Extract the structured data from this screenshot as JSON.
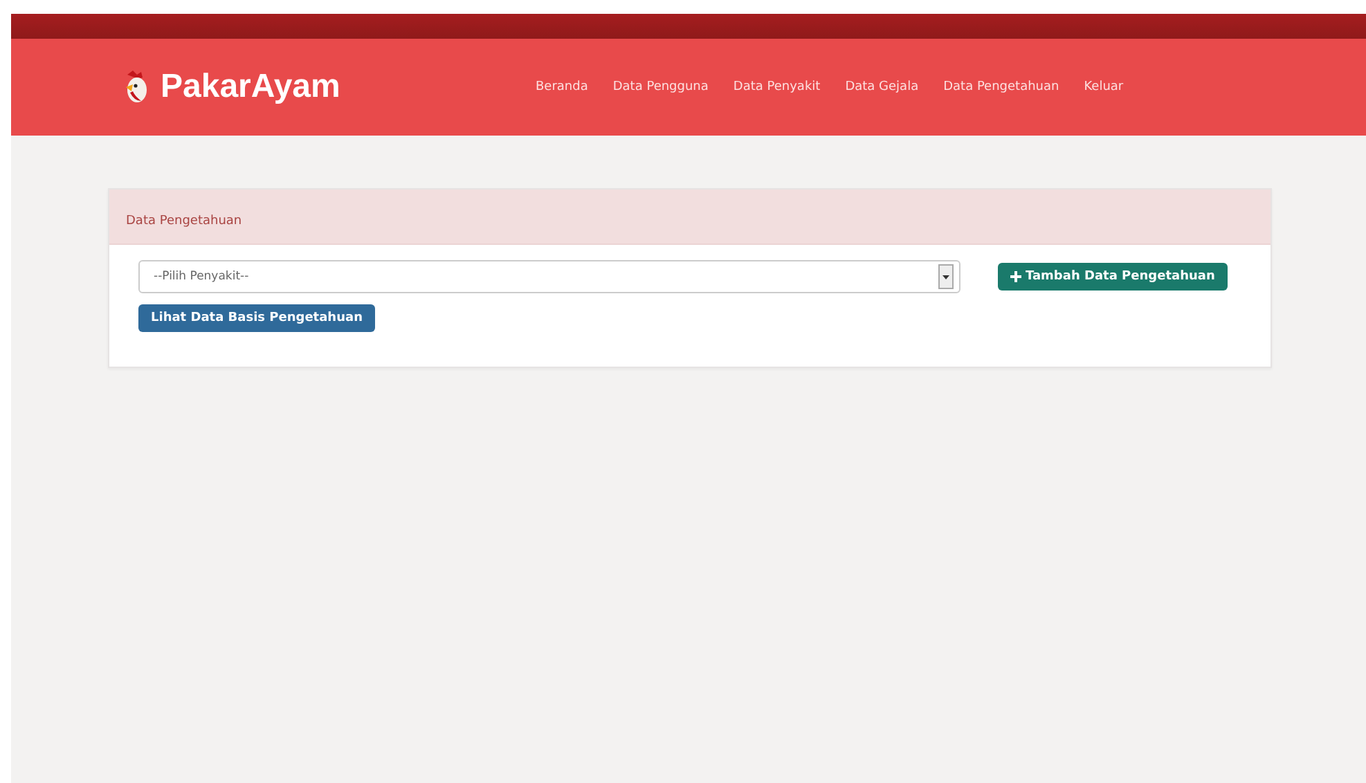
{
  "brand": {
    "name": "PakarAyam"
  },
  "nav": [
    {
      "label": "Beranda"
    },
    {
      "label": "Data Pengguna"
    },
    {
      "label": "Data Penyakit"
    },
    {
      "label": "Data Gejala"
    },
    {
      "label": "Data Pengetahuan"
    },
    {
      "label": "Keluar"
    }
  ],
  "panel": {
    "title": "Data Pengetahuan",
    "select": {
      "value": "--Pilih Penyakit--"
    },
    "add_button": {
      "label": "Tambah Data Pengetahuan"
    },
    "view_button": {
      "label": "Lihat Data Basis Pengetahuan"
    }
  }
}
